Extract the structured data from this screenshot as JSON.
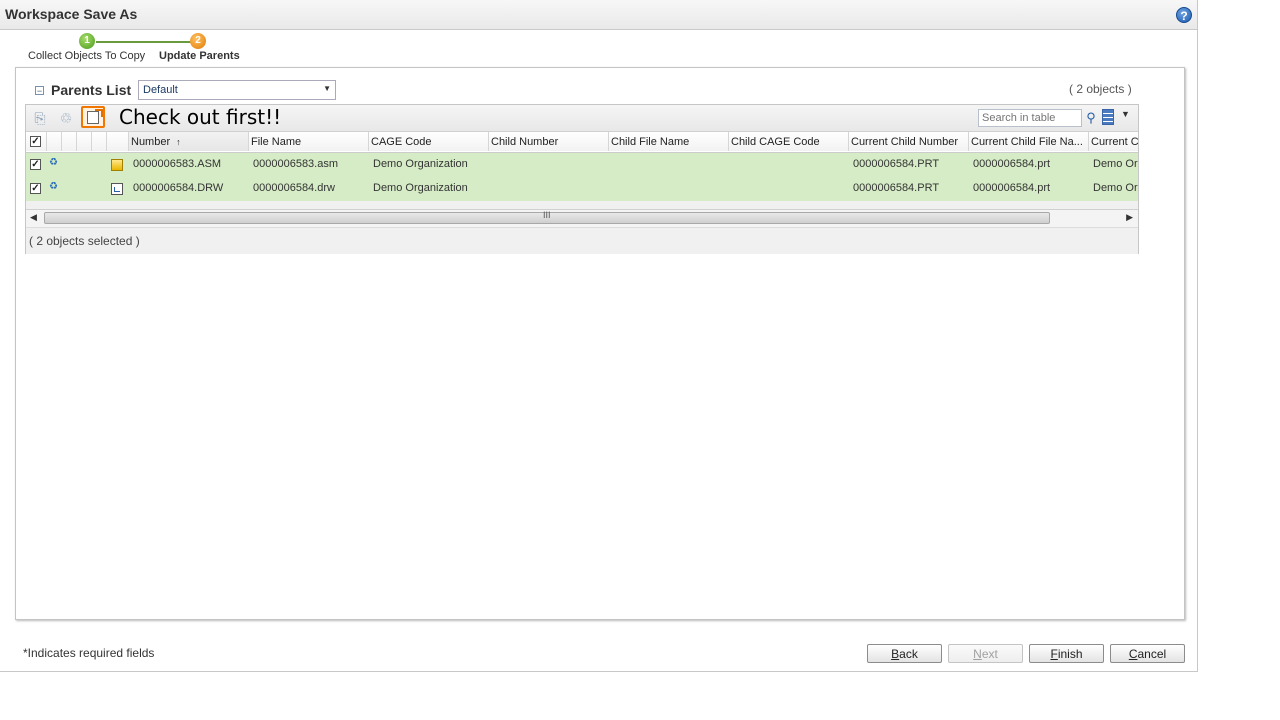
{
  "window": {
    "title": "Workspace Save As"
  },
  "wizard": {
    "steps": [
      {
        "number": "1",
        "label": "Collect Objects To Copy",
        "state": "complete",
        "color": "#4a9a1c"
      },
      {
        "number": "2",
        "label": "Update Parents",
        "state": "current",
        "color": "#e07a00"
      }
    ]
  },
  "panel": {
    "title": "Parents List",
    "view_select": {
      "value": "Default"
    },
    "object_count": "( 2 objects )",
    "annotation": "Check out first!!",
    "search": {
      "placeholder": "Search in table"
    },
    "columns": [
      {
        "label": "Number",
        "sorted": "ascending"
      },
      {
        "label": "File Name"
      },
      {
        "label": "CAGE Code"
      },
      {
        "label": "Child Number"
      },
      {
        "label": "Child File Name"
      },
      {
        "label": "Child CAGE Code"
      },
      {
        "label": "Current Child Number"
      },
      {
        "label": "Current Child File Na..."
      },
      {
        "label": "Current C"
      }
    ],
    "rows": [
      {
        "checked": true,
        "icon": "assembly-icon",
        "number": "0000006583.ASM",
        "file_name": "0000006583.asm",
        "cage_code": "Demo Organization",
        "child_number": "",
        "child_file_name": "",
        "child_cage_code": "",
        "current_child_number": "0000006584.PRT",
        "current_child_file_name": "0000006584.prt",
        "current_c": "Demo Or"
      },
      {
        "checked": true,
        "icon": "drawing-icon",
        "number": "0000006584.DRW",
        "file_name": "0000006584.drw",
        "cage_code": "Demo Organization",
        "child_number": "",
        "child_file_name": "",
        "child_cage_code": "",
        "current_child_number": "0000006584.PRT",
        "current_child_file_name": "0000006584.prt",
        "current_c": "Demo Or"
      }
    ],
    "selection_status": "( 2 objects selected )",
    "row_highlight_color": "#d6ecc6"
  },
  "footer": {
    "required_note": "*Indicates required fields",
    "buttons": {
      "back": {
        "mnemonic": "B",
        "rest": "ack",
        "enabled": true
      },
      "next": {
        "mnemonic": "N",
        "rest": "ext",
        "enabled": false
      },
      "finish": {
        "mnemonic": "F",
        "rest": "inish",
        "enabled": true
      },
      "cancel": {
        "mnemonic": "C",
        "rest": "ancel",
        "enabled": true
      }
    }
  }
}
